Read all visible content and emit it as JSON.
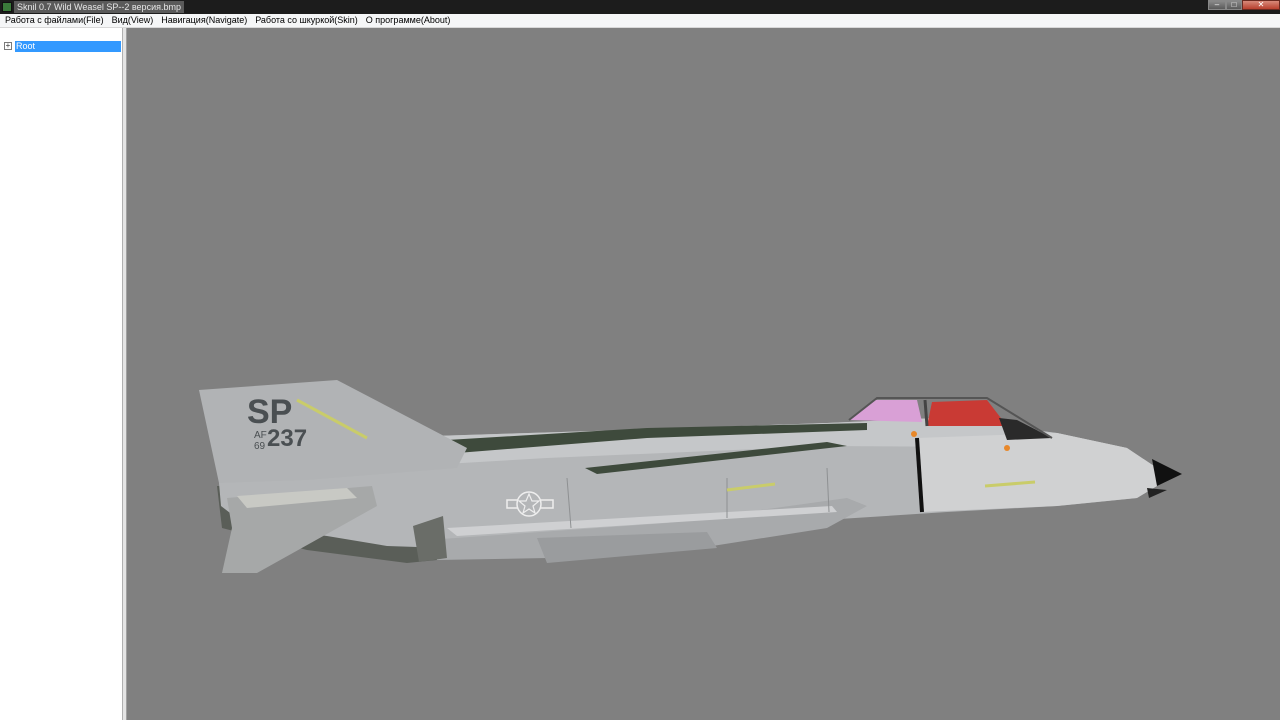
{
  "window": {
    "title": "Sknil 0.7   Wild Weasel SP--2 версия.bmp",
    "icon": "app-icon"
  },
  "menu": {
    "items": [
      "Работа с файлами(File)",
      "Вид(View)",
      "Навигация(Navigate)",
      "Работа со шкуркой(Skin)",
      "О программе(About)"
    ]
  },
  "tree": {
    "expander": "+",
    "root_label": "Root",
    "selected": true
  },
  "viewport": {
    "background": "#808080",
    "model": {
      "tail_code": "SP",
      "serial_prefix_top": "AF",
      "serial_prefix_bottom": "69",
      "serial": "237"
    }
  },
  "colors": {
    "selection": "#3399ff",
    "titlebar": "#1c1c1c",
    "menubar": "#f5f6f7",
    "fuselage": "#b4b6b8"
  }
}
